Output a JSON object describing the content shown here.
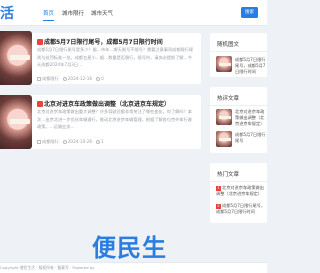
{
  "header": {
    "logo": "活",
    "nav": [
      "首页",
      "城市限行",
      "城市天气"
    ],
    "search_label": "搜索"
  },
  "articles": [
    {
      "title": "成都5月7日限行尾号，成都5月7日限行时间",
      "hot": true,
      "excerpt": "成都5月7日限行尾号是多少？据…市年…哪天限号不限号？需要注意事项成都限行规则与处罚标准一览，成都五星小…据…数量是否限行，限号时，请务必提前了解…今天成都2024年7月3日…",
      "category": "成都限行",
      "date": "2024-12-16",
      "views": "0"
    },
    {
      "title": "北京对进京车政策做出调整（北京进京车规定）",
      "hot": true,
      "excerpt": "北京对进京车政策做出重大调整？许多驾驶员都非常关注了哪些变化，你了解吗？本次…出京北进一步优化车辆通行，推动北京进京车辆管理，根据了解各位京外车行驶政策，…运输业务…",
      "category": "成都限行",
      "date": "2024-10-26",
      "views": "1"
    }
  ],
  "sidebar": {
    "featured_title": "随机图文",
    "featured": [
      "成都5月7日限行尾号，成都5月7日限行时间"
    ],
    "hot_title": "热评文章",
    "hot": [
      "北京对进京车政策做出调整（北京进京车规定）",
      "成都5月7日限行尾号"
    ],
    "popular_title": "热门文章",
    "popular": [
      "北京对进京车政策做出调整（北京进京车规定）",
      "成都5月7日限行尾号，成都5月7日限行时间"
    ]
  },
  "footer": {
    "text": "Copyright 便民生活 · 版权所有 · 备案号 · Powered by"
  },
  "watermark": "便民生",
  "colors": {
    "accent": "#2a7de1",
    "hot": "#e8433c"
  }
}
